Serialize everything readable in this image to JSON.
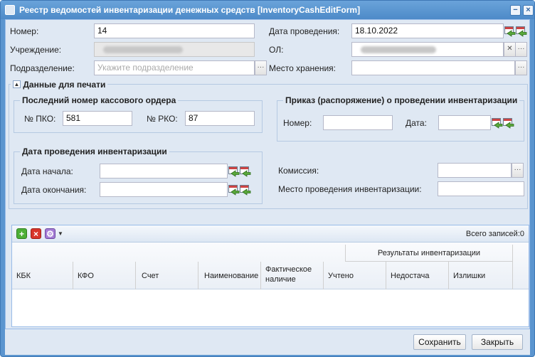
{
  "window": {
    "title": "Реестр ведомостей инвентаризации денежных средств [InventoryCashEditForm]",
    "background_ghost": "▸ Данные для печа"
  },
  "form": {
    "number_label": "Номер:",
    "number_value": "14",
    "date_label": "Дата проведения:",
    "date_value": "18.10.2022",
    "institution_label": "Учреждение:",
    "ol_label": "ОЛ:",
    "subdivision_label": "Подразделение:",
    "subdivision_placeholder": "Укажите подразделение",
    "storage_label": "Место хранения:"
  },
  "print_section": {
    "toggle_label": "Данные для печати",
    "last_order": {
      "legend": "Последний номер кассового ордера",
      "pko_label": "№ ПКО:",
      "pko_value": "581",
      "rko_label": "№ РКО:",
      "rko_value": "87"
    },
    "order": {
      "legend": "Приказ (распоряжение) о проведении инвентаризации",
      "number_label": "Номер:",
      "date_label": "Дата:"
    },
    "inventory_dates": {
      "legend": "Дата проведения инвентаризации",
      "start_label": "Дата начала:",
      "end_label": "Дата окончания:"
    },
    "commission_label": "Комиссия:",
    "place_label": "Место проведения инвентаризации:"
  },
  "grid": {
    "total_label": "Всего записей:0",
    "group_header": "Результаты инвентаризации",
    "columns": [
      "КБК",
      "КФО",
      "Счет",
      "Наименование",
      "Фактическое наличие",
      "Учтено",
      "Недостача",
      "Излишки"
    ]
  },
  "buttons": {
    "save": "Сохранить",
    "close": "Закрыть"
  }
}
